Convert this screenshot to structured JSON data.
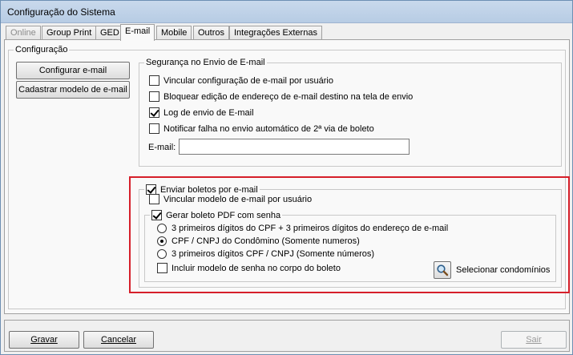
{
  "window": {
    "title": "Configuração do Sistema"
  },
  "tabs": [
    {
      "label": "Online",
      "state": "disabled"
    },
    {
      "label": "Group Print",
      "state": "normal"
    },
    {
      "label": "GED",
      "state": "normal"
    },
    {
      "label": "E-mail",
      "state": "active"
    },
    {
      "label": "Mobile",
      "state": "normal"
    },
    {
      "label": "Outros",
      "state": "normal"
    },
    {
      "label": "Integrações Externas",
      "state": "normal"
    }
  ],
  "config": {
    "legend": "Configuração",
    "configure_email_button": "Configurar e-mail",
    "register_template_button": "Cadastrar modelo de e-mail"
  },
  "security": {
    "legend": "Segurança no Envio de E-mail",
    "items": [
      {
        "label": "Vincular configuração de e-mail por usuário",
        "checked": false
      },
      {
        "label": "Bloquear edição de endereço de e-mail destino na tela de envio",
        "checked": false
      },
      {
        "label": "Log de envio de E-mail",
        "checked": true
      },
      {
        "label": "Notificar falha no envio automático de 2ª via de boleto",
        "checked": false
      }
    ],
    "email_label": "E-mail:",
    "email_value": ""
  },
  "boletos": {
    "legend": "Enviar boletos por e-mail",
    "checked": true,
    "link_template": {
      "label": "Vincular modelo de e-mail por usuário",
      "checked": false
    },
    "pdf_password": {
      "label": "Gerar boleto PDF com senha",
      "checked": true
    },
    "password_options": [
      {
        "label": "3 primeiros dígitos do CPF + 3 primeiros dígitos do endereço de e-mail",
        "selected": false
      },
      {
        "label": "CPF / CNPJ do Condômino (Somente numeros)",
        "selected": true
      },
      {
        "label": "3 primeiros dígitos CPF / CNPJ (Somente números)",
        "selected": false
      }
    ],
    "include_template": {
      "label": "Incluir modelo de senha no corpo do boleto",
      "checked": false
    },
    "select_condos_button": "Selecionar condomínios"
  },
  "footer": {
    "save": "Gravar",
    "cancel": "Cancelar",
    "exit": "Sair"
  },
  "colors": {
    "highlight": "#d61f2a",
    "titlebar": "#c9d9ec"
  }
}
